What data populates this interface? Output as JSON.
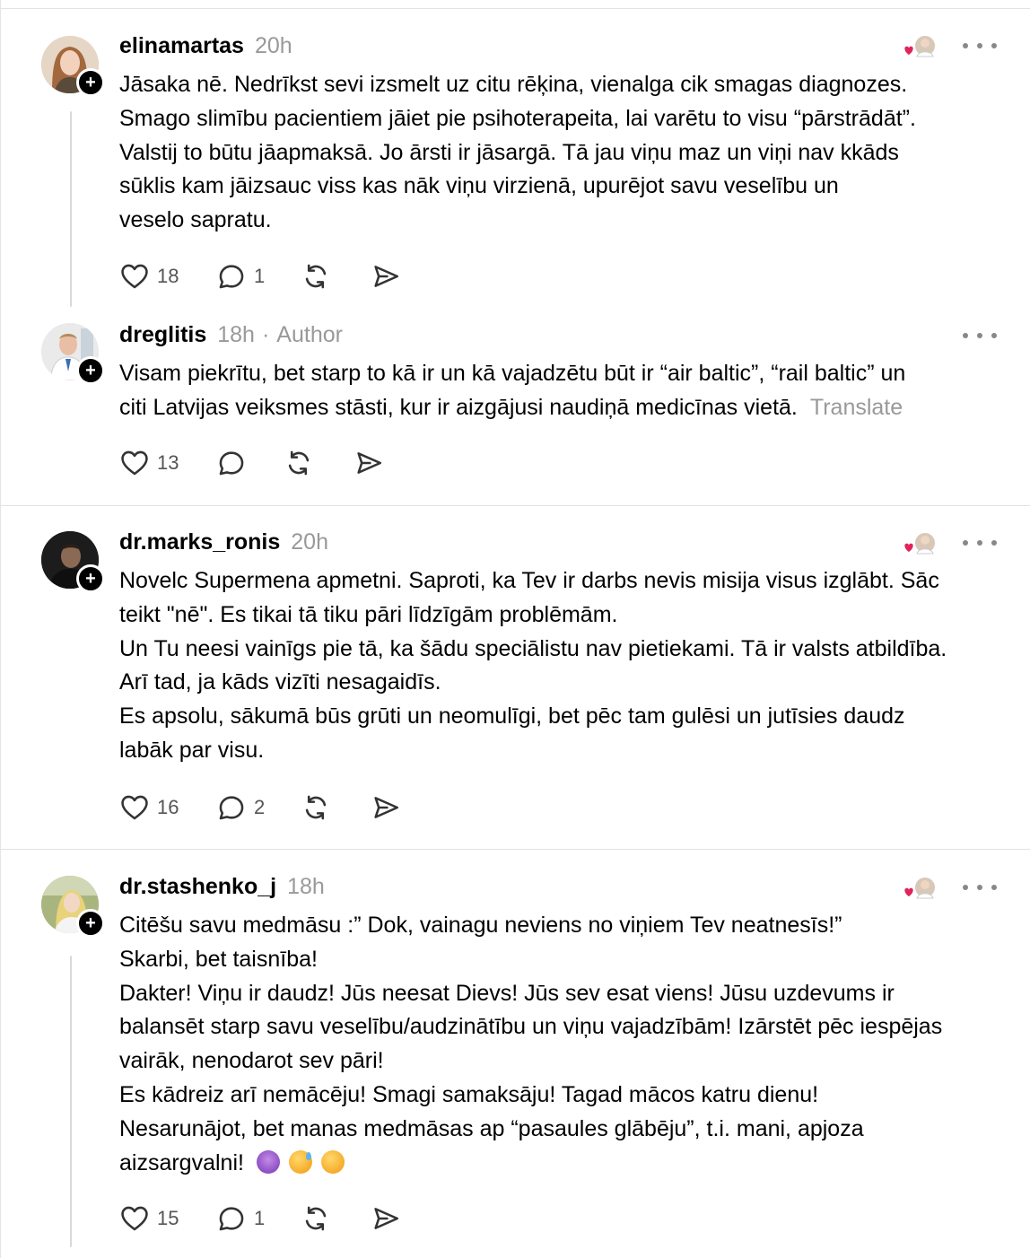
{
  "posts": [
    {
      "username": "elinamartas",
      "time": "20h",
      "lines": [
        "Jāsaka nē. Nedrīkst sevi izsmelt uz citu rēķina, vienalga cik smagas diagnozes.",
        "Smago slimību pacientiem jāiet pie psihoterapeita, lai varētu to visu “pārstrādāt”.",
        "Valstij to būtu jāapmaksā. Jo ārsti ir jāsargā. Tā jau viņu maz un viņi nav kkāds",
        "sūklis kam jāizsauc viss kas nāk viņu virzienā, upurējot savu veselību un",
        "veselo sapratu."
      ],
      "likes": "18",
      "replies": "1"
    },
    {
      "username": "dreglitis",
      "time": "18h",
      "separator": "·",
      "author_label": "Author",
      "lines": [
        "Visam piekrītu, bet starp to kā ir un kā vajadzētu būt ir “air baltic”, “rail baltic” un",
        "citi Latvijas veiksmes stāsti, kur ir aizgājusi naudiņā medicīnas vietā."
      ],
      "translate": "Translate",
      "likes": "13",
      "replies": ""
    },
    {
      "username": "dr.marks_ronis",
      "time": "20h",
      "lines": [
        "Novelc Supermena apmetni. Saproti, ka Tev ir darbs nevis misija visus izglābt. Sāc",
        "teikt \"nē\". Es tikai tā tiku pāri līdzīgām problēmām.",
        "Un Tu neesi vainīgs pie tā, ka šādu speciālistu nav pietiekami. Tā ir valsts atbildība.",
        "Arī tad, ja kāds vizīti nesagaidīs.",
        "Es apsolu, sākumā būs grūti un neomulīgi, bet pēc tam gulēsi un jutīsies daudz",
        "labāk par visu."
      ],
      "likes": "16",
      "replies": "2"
    },
    {
      "username": "dr.stashenko_j",
      "time": "18h",
      "lines": [
        "Citēšu savu medmāsu :” Dok, vainagu neviens no viņiem Tev neatnesīs!”",
        "Skarbi, bet taisnība!",
        "Dakter! Viņu ir daudz! Jūs neesat Dievs! Jūs sev esat viens! Jūsu uzdevums ir",
        "balansēt starp savu veselību/audzinātību un viņu vajadzībām! Izārstēt pēc iespējas",
        "vairāk, nenodarot sev pāri!",
        "Es kādreiz arī nemācēju! Smagi samaksāju! Tagad mācos katru dienu!",
        "Nesarunājot, bet manas medmāsas ap “pasaules glābēju”, t.i. mani, apjoza",
        "aizsargvalni!"
      ],
      "emojis": [
        "person-shrugging-emoji",
        "grinning-sweat-emoji",
        "grinning-emoji"
      ],
      "likes": "15",
      "replies": "1"
    }
  ],
  "colors": {
    "text": "#000000",
    "muted": "#999999",
    "icon": "#333333",
    "heart": "#e0245e",
    "divider": "#e3e3e3"
  }
}
